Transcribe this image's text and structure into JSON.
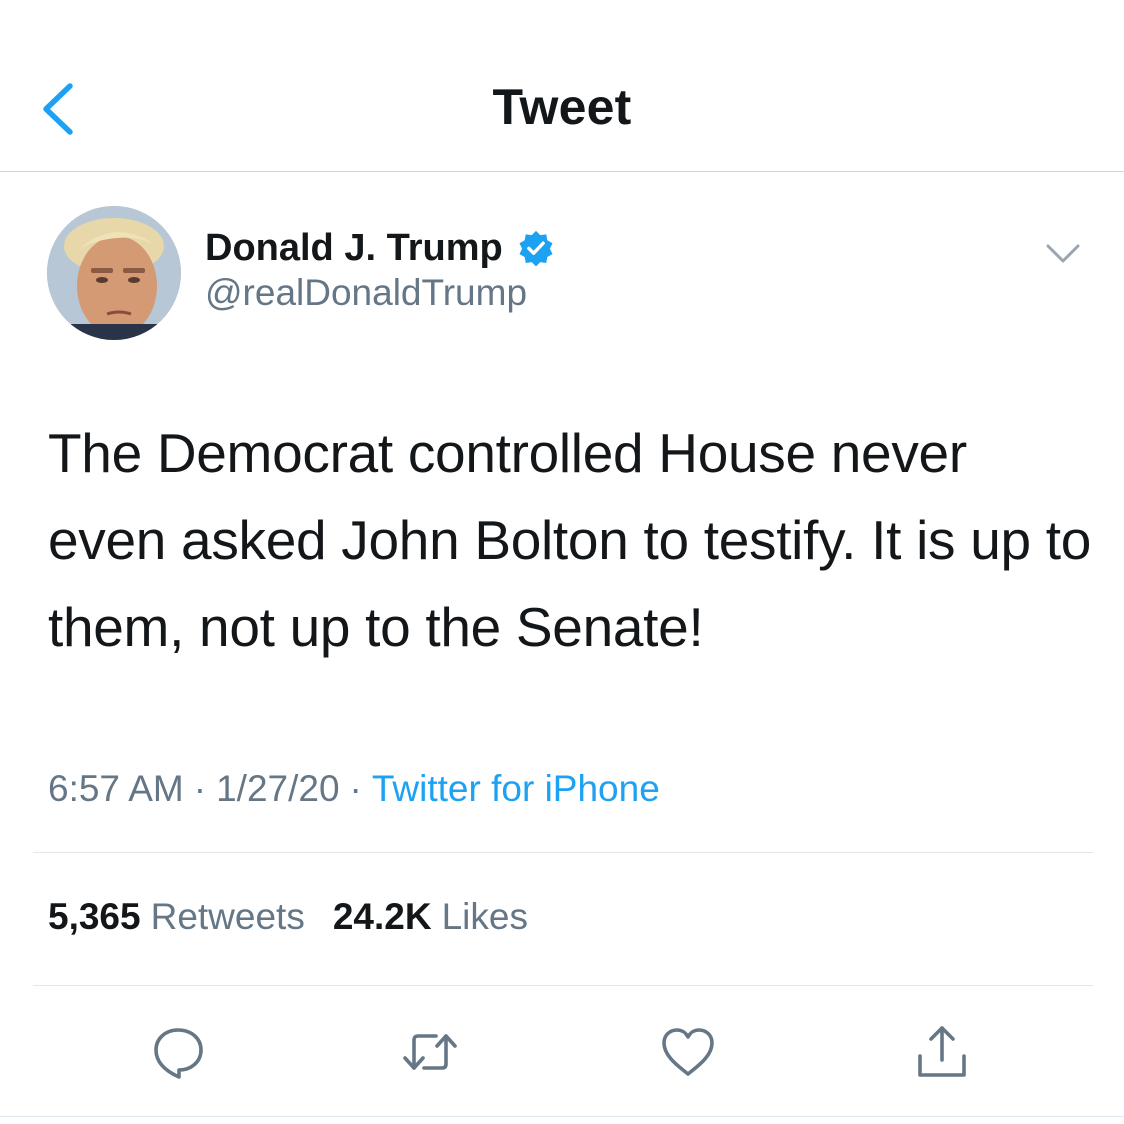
{
  "header": {
    "title": "Tweet",
    "back_icon": "chevron-left-icon"
  },
  "author": {
    "name": "Donald J. Trump",
    "handle": "@realDonaldTrump",
    "verified": true,
    "avatar_icon": "avatar-photo",
    "menu_icon": "chevron-down-icon"
  },
  "tweet": {
    "text": "The Democrat controlled House never even asked John Bolton to testify. It is up to them, not up to the Senate!",
    "time": "6:57 AM",
    "date": "1/27/20",
    "separator": "·",
    "source": "Twitter for iPhone"
  },
  "stats": {
    "retweets_count": "5,365",
    "retweets_label": "Retweets",
    "likes_count": "24.2K",
    "likes_label": "Likes"
  },
  "actions": [
    {
      "name": "reply",
      "icon": "reply-icon"
    },
    {
      "name": "retweet",
      "icon": "retweet-icon"
    },
    {
      "name": "like",
      "icon": "heart-icon"
    },
    {
      "name": "share",
      "icon": "share-icon"
    }
  ],
  "colors": {
    "accent": "#1da1f2",
    "text_primary": "#14171a",
    "text_secondary": "#657786",
    "divider": "#e1e8ed",
    "verified": "#1da1f2"
  }
}
